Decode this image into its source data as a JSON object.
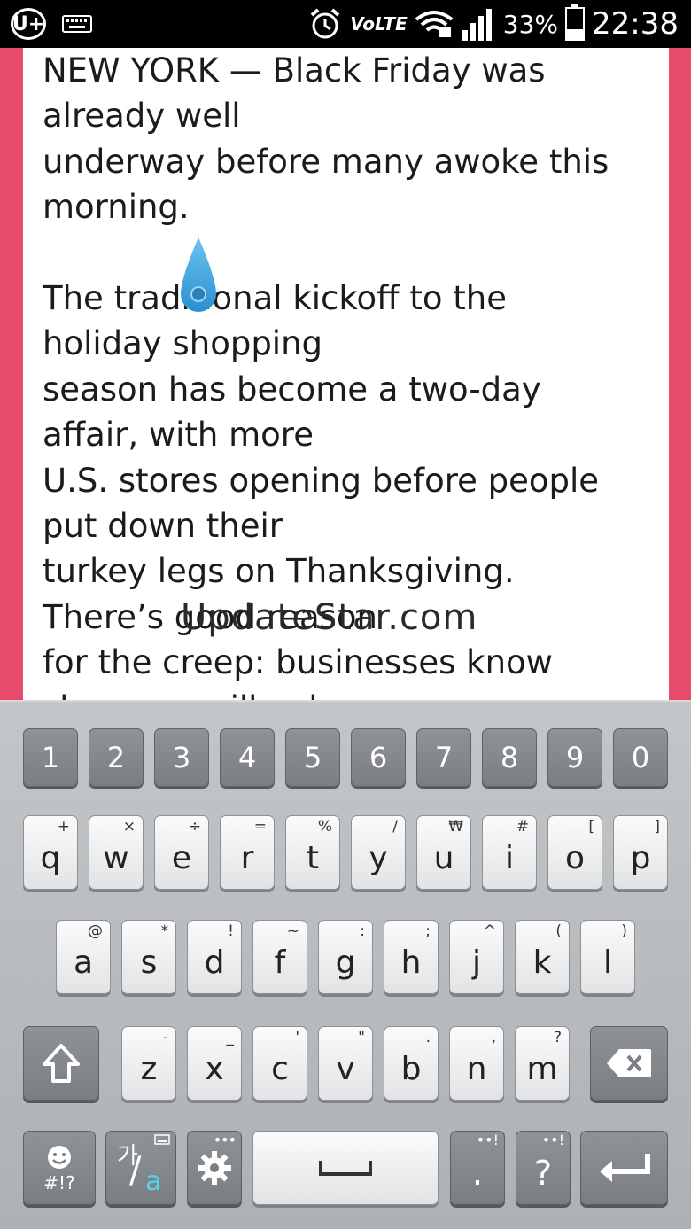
{
  "statusbar": {
    "carrier_badge": "U+",
    "lte": "VoLTE",
    "battery_percent": "33%",
    "battery_level": 0.33,
    "time": "22:38",
    "icons": [
      "uplus-logo-icon",
      "keyboard-icon",
      "alarm-icon",
      "volte-icon",
      "wifi-icon",
      "signal-icon",
      "battery-icon"
    ]
  },
  "reader": {
    "accent_color": "#e84a6c",
    "lines": [
      "NEW YORK — Black Friday was",
      "already well",
      "underway before many awoke this",
      "morning.",
      "",
      "The traditional kickoff to the",
      "holiday shopping",
      "season has become a two-day",
      "affair, with more",
      "U.S. stores opening before people",
      "put down their",
      "turkey legs on Thanksgiving.",
      "There’s good reason",
      "for the creep: businesses know",
      "shoppers will only"
    ],
    "watermark": "UpdateStar.com"
  },
  "keyboard": {
    "number_row": [
      "1",
      "2",
      "3",
      "4",
      "5",
      "6",
      "7",
      "8",
      "9",
      "0"
    ],
    "row1": [
      {
        "key": "q",
        "sub": "+"
      },
      {
        "key": "w",
        "sub": "×"
      },
      {
        "key": "e",
        "sub": "÷"
      },
      {
        "key": "r",
        "sub": "="
      },
      {
        "key": "t",
        "sub": "%"
      },
      {
        "key": "y",
        "sub": "/"
      },
      {
        "key": "u",
        "sub": "₩"
      },
      {
        "key": "i",
        "sub": "#"
      },
      {
        "key": "o",
        "sub": "["
      },
      {
        "key": "p",
        "sub": "]"
      }
    ],
    "row2": [
      {
        "key": "a",
        "sub": "@"
      },
      {
        "key": "s",
        "sub": "*"
      },
      {
        "key": "d",
        "sub": "!"
      },
      {
        "key": "f",
        "sub": "~"
      },
      {
        "key": "g",
        "sub": ":"
      },
      {
        "key": "h",
        "sub": ";"
      },
      {
        "key": "j",
        "sub": "^"
      },
      {
        "key": "k",
        "sub": "("
      },
      {
        "key": "l",
        "sub": ")"
      }
    ],
    "row3": [
      {
        "key": "z",
        "sub": "-"
      },
      {
        "key": "x",
        "sub": "_"
      },
      {
        "key": "c",
        "sub": "'"
      },
      {
        "key": "v",
        "sub": "\""
      },
      {
        "key": "b",
        "sub": "."
      },
      {
        "key": "n",
        "sub": ","
      },
      {
        "key": "m",
        "sub": "?"
      }
    ],
    "emoji_label": "#!?",
    "lang_top": "가",
    "lang_bottom": "a",
    "period": ".",
    "question": "?"
  }
}
